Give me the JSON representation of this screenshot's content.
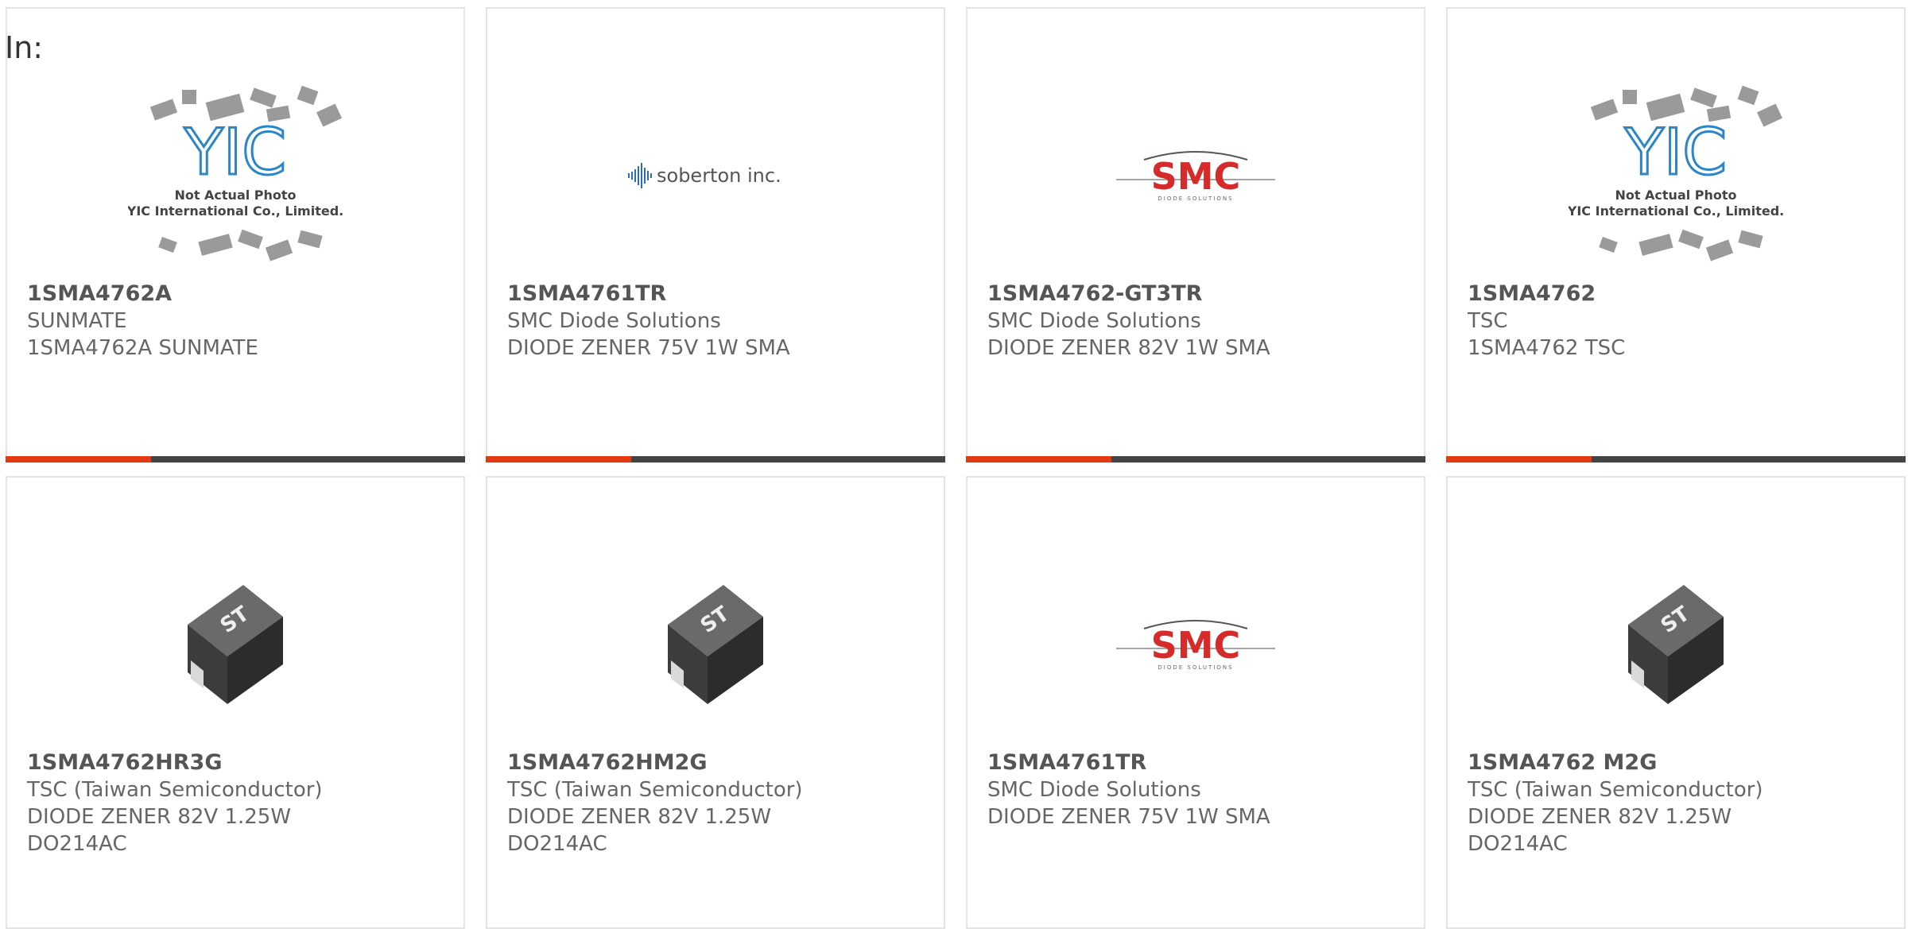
{
  "filter_label": "In:",
  "colors": {
    "accent": "#e23b12",
    "bar": "#444444",
    "smc_red": "#d62b2b",
    "yic_blue": "#2b86c8"
  },
  "products": [
    {
      "part": "1SMA4762A",
      "manufacturer": "SUNMATE",
      "desc": [
        "1SMA4762A SUNMATE"
      ],
      "image": "yic-placeholder",
      "yic_line1": "Not Actual Photo",
      "yic_line2": "YIC International Co., Limited."
    },
    {
      "part": "1SMA4761TR",
      "manufacturer": "SMC Diode Solutions",
      "desc": [
        "DIODE ZENER 75V 1W SMA"
      ],
      "image": "soberton-logo",
      "logo_text": "soberton inc."
    },
    {
      "part": "1SMA4762-GT3TR",
      "manufacturer": "SMC Diode Solutions",
      "desc": [
        "DIODE ZENER 82V 1W SMA"
      ],
      "image": "smc-logo",
      "logo_text": "SMC",
      "logo_sub": "DIODE SOLUTIONS"
    },
    {
      "part": "1SMA4762",
      "manufacturer": "TSC",
      "desc": [
        "1SMA4762 TSC"
      ],
      "image": "yic-placeholder",
      "yic_line1": "Not Actual Photo",
      "yic_line2": "YIC International Co., Limited."
    },
    {
      "part": "1SMA4762HR3G",
      "manufacturer": "TSC (Taiwan Semiconductor)",
      "desc": [
        "DIODE ZENER 82V 1.25W",
        "DO214AC"
      ],
      "image": "sma-package"
    },
    {
      "part": "1SMA4762HM2G",
      "manufacturer": "TSC (Taiwan Semiconductor)",
      "desc": [
        "DIODE ZENER 82V 1.25W",
        "DO214AC"
      ],
      "image": "sma-package"
    },
    {
      "part": "1SMA4761TR",
      "manufacturer": "SMC Diode Solutions",
      "desc": [
        "DIODE ZENER 75V 1W SMA"
      ],
      "image": "smc-logo",
      "logo_text": "SMC",
      "logo_sub": "DIODE SOLUTIONS"
    },
    {
      "part": "1SMA4762 M2G",
      "manufacturer": "TSC (Taiwan Semiconductor)",
      "desc": [
        "DIODE ZENER 82V 1.25W",
        "DO214AC"
      ],
      "image": "sma-package"
    }
  ]
}
